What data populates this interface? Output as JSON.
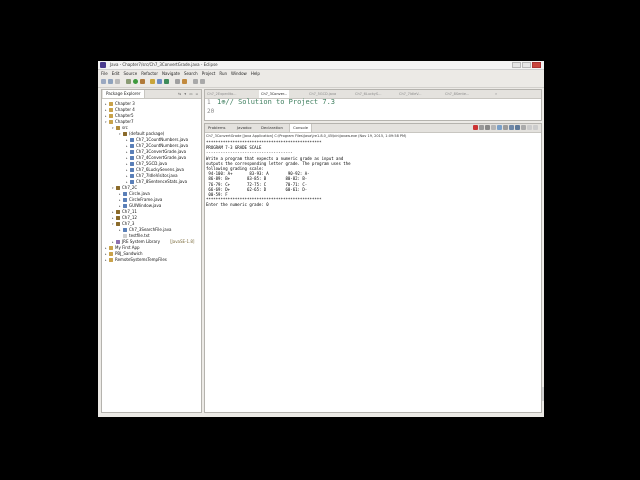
{
  "window": {
    "title": "Java - Chapter7/src/Ch7_3ConvertGrade.java - Eclipse"
  },
  "menubar": [
    "File",
    "Edit",
    "Source",
    "Refactor",
    "Navigate",
    "Search",
    "Project",
    "Run",
    "Window",
    "Help"
  ],
  "toolbar": {
    "quick_access_placeholder": "Quick Access",
    "perspective_label": "Java"
  },
  "package_explorer": {
    "tab_label": "Package Explorer",
    "items": [
      {
        "label": "Chapter 3",
        "depth": 0,
        "arrow": "▸",
        "icon": "project-icon"
      },
      {
        "label": "Chapter 4",
        "depth": 0,
        "arrow": "▸",
        "icon": "project-icon"
      },
      {
        "label": "Chapter5",
        "depth": 0,
        "arrow": "▸",
        "icon": "project-icon"
      },
      {
        "label": "Chapter7",
        "depth": 0,
        "arrow": "▾",
        "icon": "project-icon"
      },
      {
        "label": "src",
        "depth": 1,
        "arrow": "▾",
        "icon": "source-folder-icon"
      },
      {
        "label": "(default package)",
        "depth": 2,
        "arrow": "▾",
        "icon": "package-icon"
      },
      {
        "label": "Ch7_1CountNumbers.java",
        "depth": 3,
        "arrow": "▸",
        "icon": "java-file-icon"
      },
      {
        "label": "Ch7_2CountNumbers.java",
        "depth": 3,
        "arrow": "▸",
        "icon": "java-file-icon"
      },
      {
        "label": "Ch7_3ConvertGrade.java",
        "depth": 3,
        "arrow": "▸",
        "icon": "java-file-icon"
      },
      {
        "label": "Ch7_4ConvertGrade.java",
        "depth": 3,
        "arrow": "▸",
        "icon": "java-file-icon"
      },
      {
        "label": "Ch7_5GCD.java",
        "depth": 3,
        "arrow": "▸",
        "icon": "java-file-icon"
      },
      {
        "label": "Ch7_6LuckySevens.java",
        "depth": 3,
        "arrow": "▸",
        "icon": "java-file-icon"
      },
      {
        "label": "Ch7_7IdleVisitor.java",
        "depth": 3,
        "arrow": "▸",
        "icon": "java-file-icon"
      },
      {
        "label": "Ch7_8SentenceStats.java",
        "depth": 3,
        "arrow": "▸",
        "icon": "java-file-icon"
      },
      {
        "label": "Ch7_2C",
        "depth": 1,
        "arrow": "▾",
        "icon": "package-icon"
      },
      {
        "label": "Circle.java",
        "depth": 2,
        "arrow": "▸",
        "icon": "java-file-icon"
      },
      {
        "label": "CircleFrame.java",
        "depth": 2,
        "arrow": "▸",
        "icon": "java-file-icon"
      },
      {
        "label": "GUIWindow.java",
        "depth": 2,
        "arrow": "▸",
        "icon": "java-file-icon"
      },
      {
        "label": "Ch7_11",
        "depth": 1,
        "arrow": "▸",
        "icon": "package-icon"
      },
      {
        "label": "Ch7_12",
        "depth": 1,
        "arrow": "▸",
        "icon": "package-icon"
      },
      {
        "label": "Ch7_3",
        "depth": 1,
        "arrow": "▾",
        "icon": "package-icon"
      },
      {
        "label": "Ch7_3SearchFile.java",
        "depth": 2,
        "arrow": "▸",
        "icon": "java-file-icon"
      },
      {
        "label": "testfile.txt",
        "depth": 2,
        "arrow": "",
        "icon": "text-file-icon"
      },
      {
        "label": "JRE System Library",
        "depth": 1,
        "arrow": "▸",
        "icon": "library-icon",
        "decoration": "[JavaSE-1.8]"
      },
      {
        "label": "My First App",
        "depth": 0,
        "arrow": "▸",
        "icon": "project-icon"
      },
      {
        "label": "PBJ_Sandwich",
        "depth": 0,
        "arrow": "▸",
        "icon": "project-icon"
      },
      {
        "label": "RemoteSystemsTempFiles",
        "depth": 0,
        "arrow": "▸",
        "icon": "project-icon"
      }
    ]
  },
  "editor": {
    "tabs": [
      {
        "label": "Ch7_2Expedito...",
        "active": false
      },
      {
        "label": "Ch7_3Conver...",
        "active": true
      },
      {
        "label": "Ch7_5GCD.java",
        "active": false
      },
      {
        "label": "Ch7_6LuckyS...",
        "active": false
      },
      {
        "label": "Ch7_7IdleV...",
        "active": false
      },
      {
        "label": "Ch7_8Sente...",
        "active": false
      }
    ],
    "overflow_label": "»",
    "line_numbers": [
      "1",
      "20"
    ],
    "code_line": "1⊕// Solution to Project 7.3"
  },
  "console": {
    "tabs": [
      {
        "label": "Problems",
        "active": false
      },
      {
        "label": "Javadoc",
        "active": false
      },
      {
        "label": "Declaration",
        "active": false
      },
      {
        "label": "Console",
        "active": true
      }
    ],
    "info": "Ch7_3ConvertGrade [Java Application] C:\\Program Files\\Java\\jre1.8.0_45\\bin\\javaw.exe (Nov 19, 2015, 1:09:58 PM)",
    "output": [
      "************************************************",
      "PROGRAM 7-3 GRADE SCALE",
      "------------------------------------",
      "Write a program that expects a numeric grade as input and",
      "outputs the corresponding letter grade. The program uses the",
      "following grading scale:",
      " 94-100: A+       83-93: A        90-92: A-",
      " 86-89: B+       83-85: B        80-82: B-",
      " 76-79: C+       72-75: C        70-71: C-",
      " 66-69: D+       62-65: D        60-61: D-",
      " 00-59: F",
      "************************************************",
      "Enter the numeric grade: 0"
    ]
  }
}
